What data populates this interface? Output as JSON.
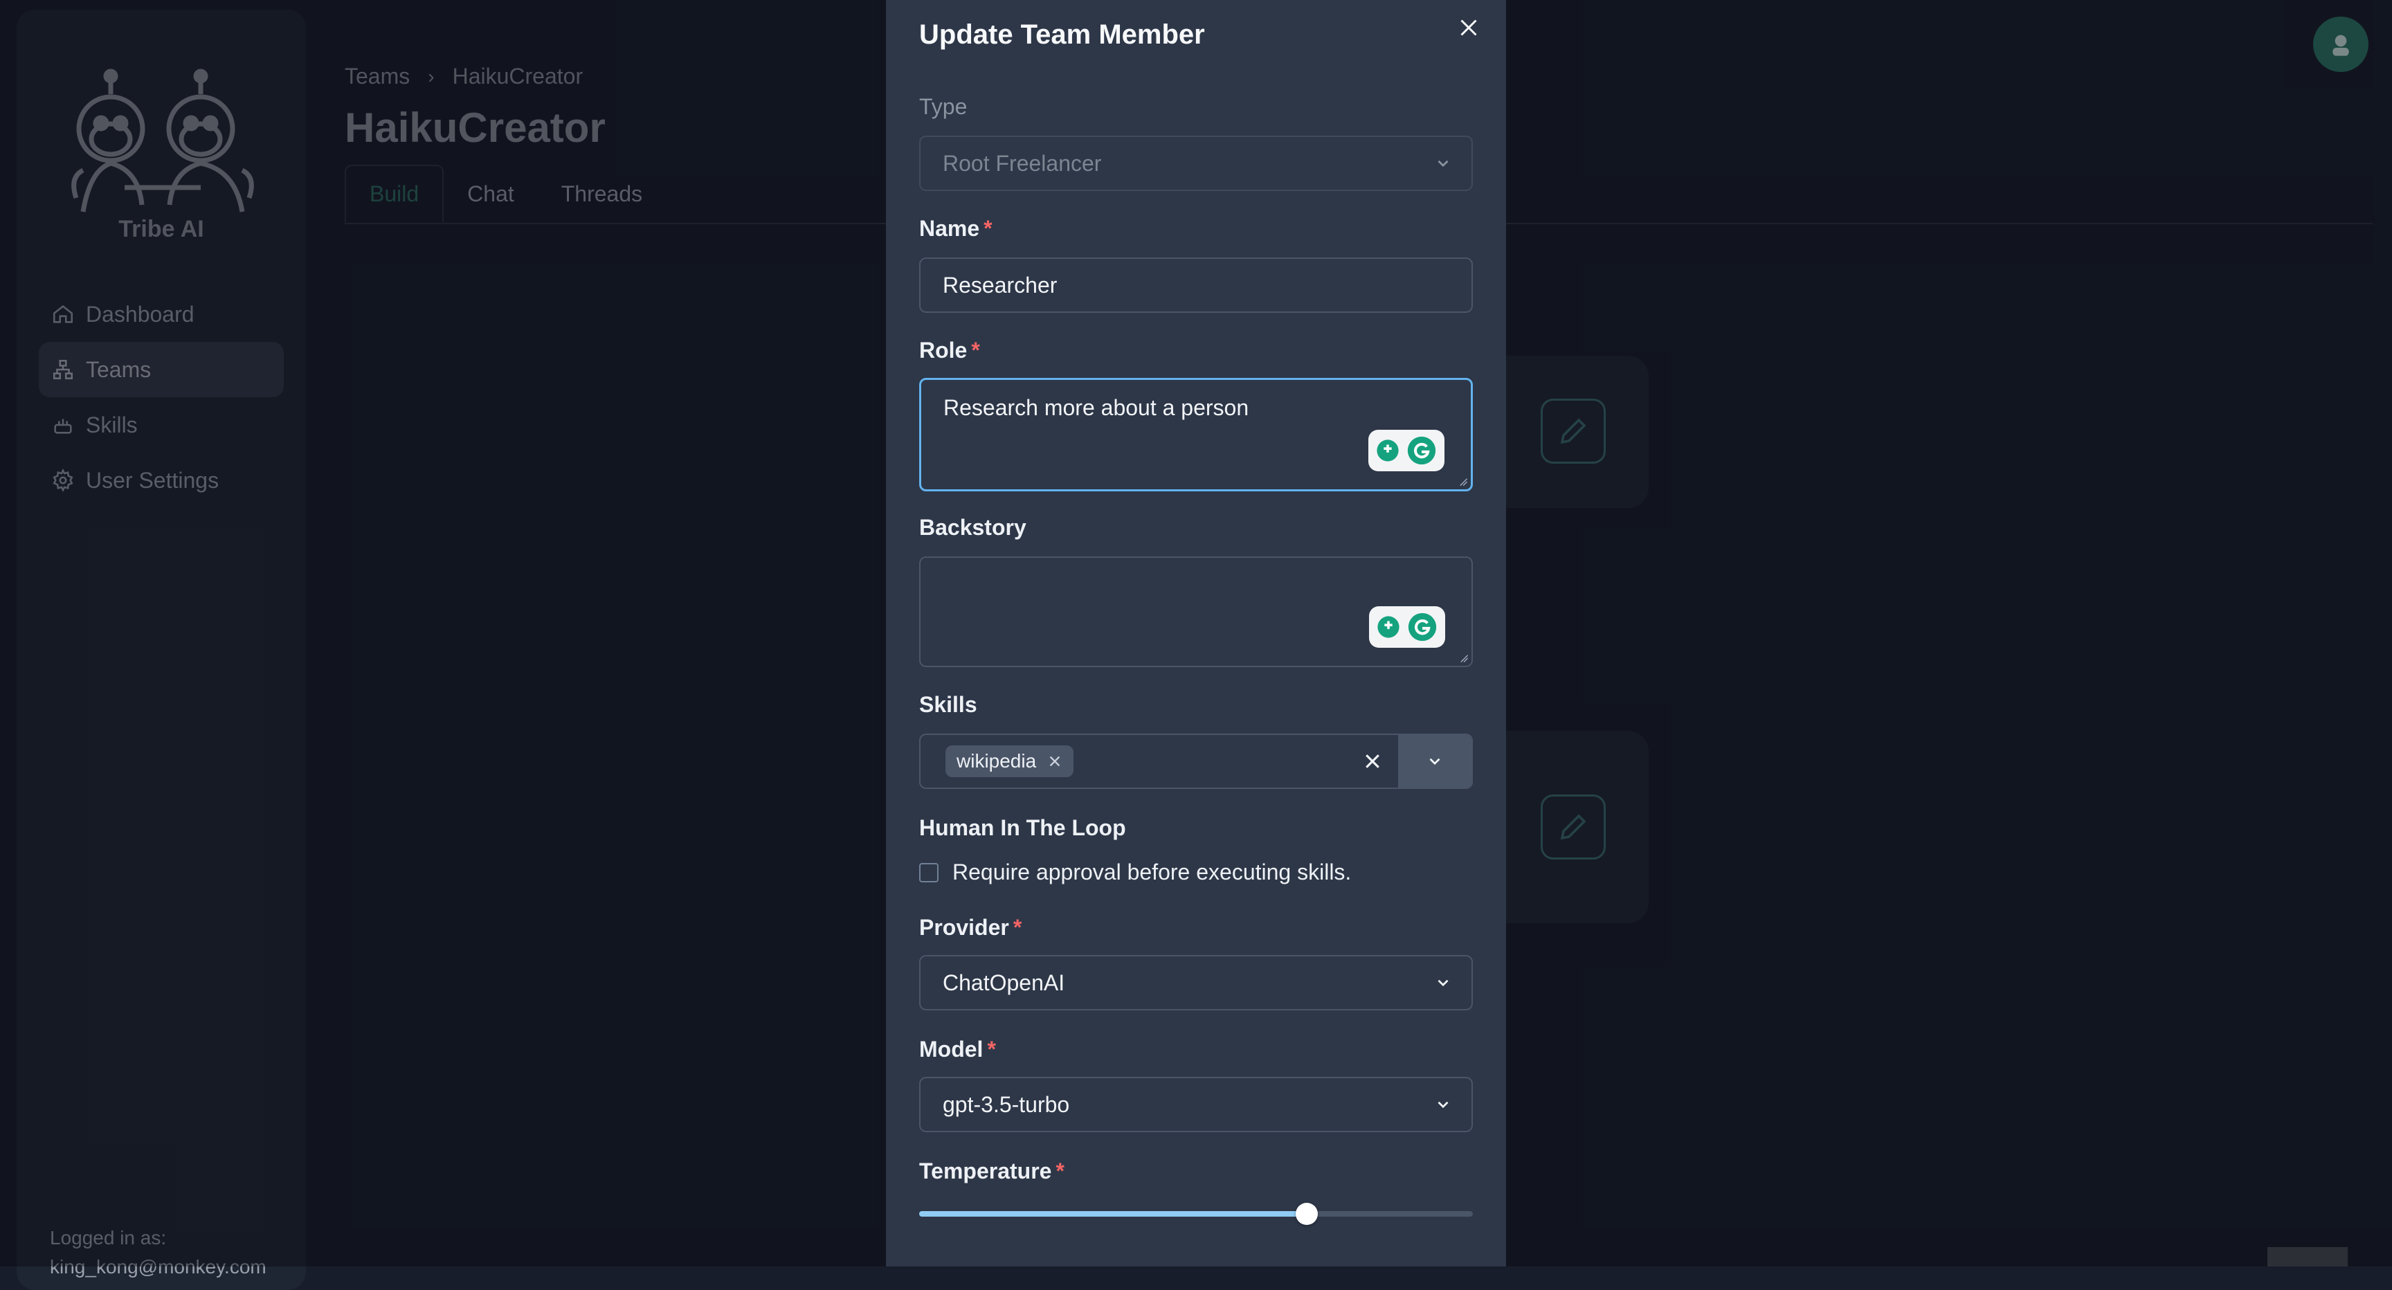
{
  "app": {
    "brand": "Tribe AI",
    "nav": [
      {
        "label": "Dashboard",
        "icon": "home-icon"
      },
      {
        "label": "Teams",
        "icon": "teams-icon",
        "active": true
      },
      {
        "label": "Skills",
        "icon": "skills-icon"
      },
      {
        "label": "User Settings",
        "icon": "gear-icon"
      }
    ],
    "logged_in_label": "Logged in as:",
    "logged_in_email": "king_kong@monkey.com"
  },
  "main": {
    "breadcrumb": [
      "Teams",
      "HaikuCreator"
    ],
    "title": "HaikuCreator",
    "tabs": [
      "Build",
      "Chat",
      "Threads"
    ],
    "active_tab": "Build"
  },
  "modal": {
    "title": "Update Team Member",
    "type_label": "Type",
    "type_value": "Root Freelancer",
    "name_label": "Name",
    "name_value": "Researcher",
    "role_label": "Role",
    "role_value": "Research more about a person",
    "backstory_label": "Backstory",
    "backstory_value": "",
    "skills_label": "Skills",
    "skills": [
      "wikipedia"
    ],
    "hitl_label": "Human In The Loop",
    "hitl_checkbox_label": "Require approval before executing skills.",
    "hitl_checked": false,
    "provider_label": "Provider",
    "provider_value": "ChatOpenAI",
    "model_label": "Model",
    "model_value": "gpt-3.5-turbo",
    "temperature_label": "Temperature",
    "temperature_fraction": 0.7,
    "required_mark": "*"
  },
  "colors": {
    "accent": "#63b3ed",
    "brand_green": "#2a7a69",
    "required": "#f56565"
  }
}
